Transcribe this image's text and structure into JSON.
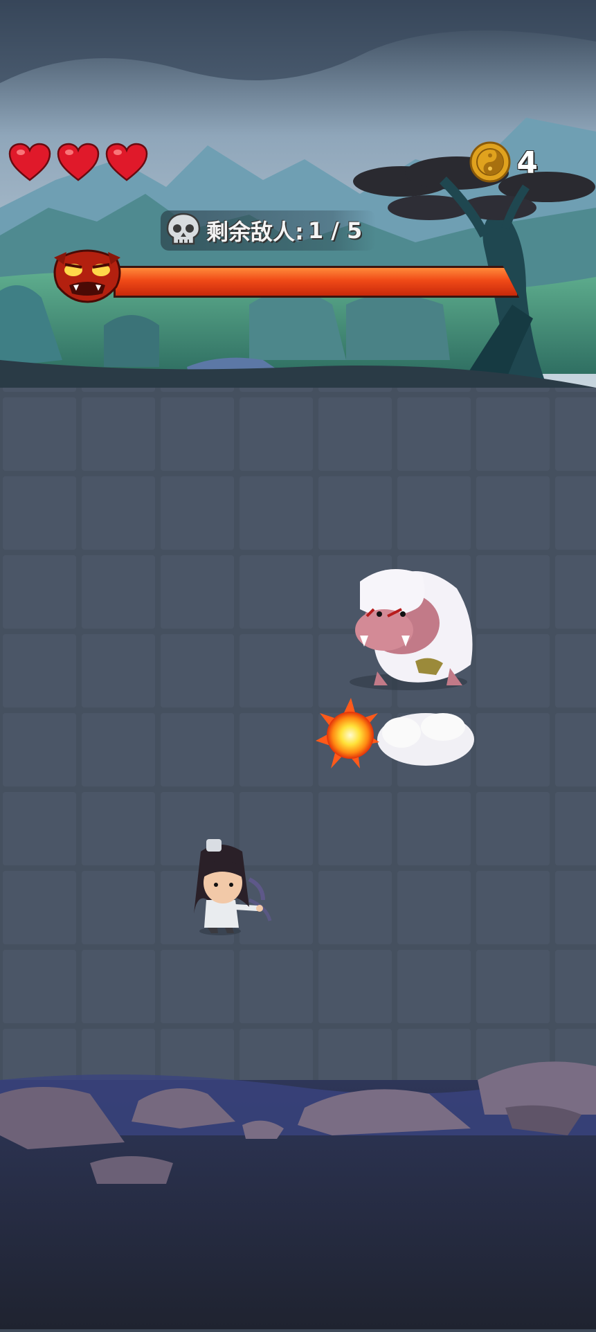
{
  "hud": {
    "lives": 3,
    "coins": "4",
    "enemies_label": "剩余敌人:",
    "enemies_count": "1 / 5",
    "boss_health_fraction": 1.0
  },
  "icons": {
    "heart": "heart-icon",
    "coin": "yin-yang-coin-icon",
    "skull": "skull-icon",
    "boss": "demon-mask-icon"
  },
  "colors": {
    "heart": "#e0192a",
    "coin": "#e0a21e",
    "boss_bar": "#f04a17",
    "floor": "#45505f"
  }
}
